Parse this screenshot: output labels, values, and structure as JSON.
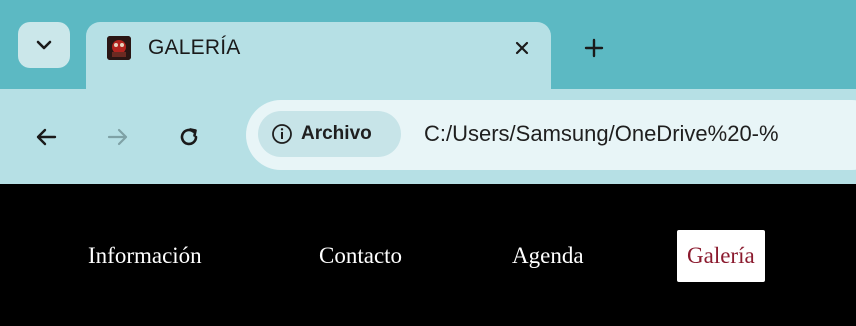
{
  "browser": {
    "tab": {
      "title": "GALERÍA",
      "favicon": "site-favicon",
      "close_icon": "close-icon"
    },
    "tab_list_icon": "chevron-down-icon",
    "new_tab_icon": "plus-icon",
    "toolbar": {
      "back_icon": "back-arrow-icon",
      "forward_icon": "forward-arrow-icon",
      "reload_icon": "reload-icon",
      "site_chip": {
        "icon": "info-icon",
        "label": "Archivo"
      },
      "url": "C:/Users/Samsung/OneDrive%20-%"
    },
    "colors": {
      "tabstrip": "#5cb9c3",
      "active_tab": "#b6e0e5",
      "omnibox": "#e8f5f7"
    }
  },
  "site_nav": {
    "items": [
      {
        "label": "Información",
        "active": false
      },
      {
        "label": "Contacto",
        "active": false
      },
      {
        "label": "Agenda",
        "active": false
      },
      {
        "label": "Galería",
        "active": true
      }
    ],
    "colors": {
      "background": "#000000",
      "link": "#ffffff",
      "active_bg": "#ffffff",
      "active_text": "#8b1a2e"
    }
  }
}
